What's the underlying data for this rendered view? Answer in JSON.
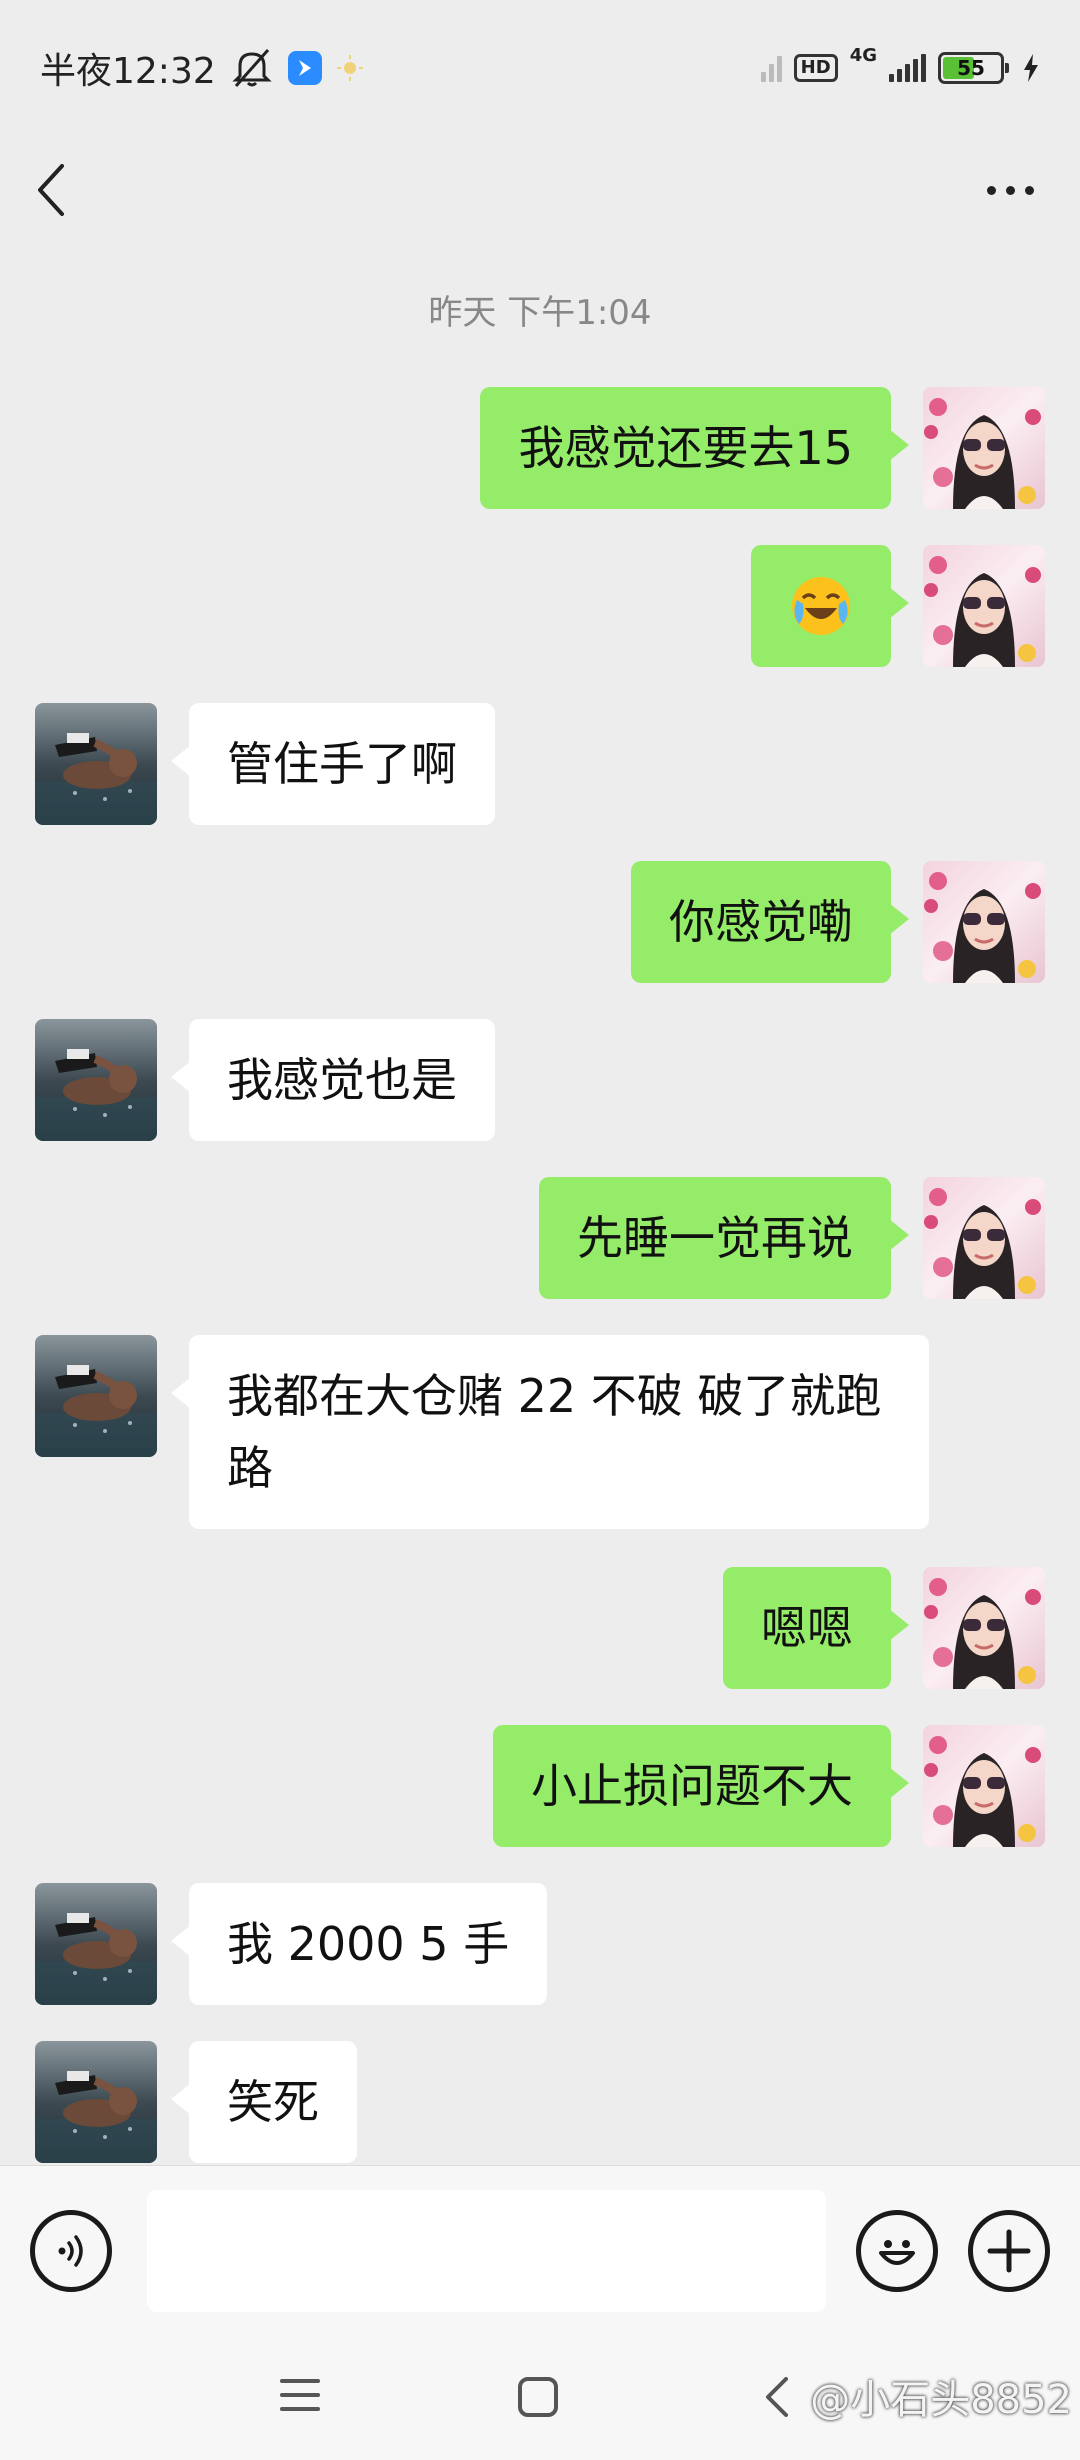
{
  "status_bar": {
    "time": "半夜12:32",
    "network_type": "4G",
    "hd_label": "HD",
    "battery_level": "55",
    "icons": [
      "mute-icon",
      "app-notification-icon",
      "weather-icon",
      "signal-icon",
      "battery-icon",
      "charging-icon"
    ]
  },
  "nav": {
    "back_icon": "chevron-left-icon",
    "title": "",
    "more_icon": "more-dots-icon"
  },
  "chat": {
    "timestamp": "昨天 下午1:04",
    "messages": [
      {
        "side": "right",
        "text": "我感觉还要去15"
      },
      {
        "side": "right",
        "text": "",
        "emoji": "crying-laughing-emoji"
      },
      {
        "side": "left",
        "text": "管住手了啊"
      },
      {
        "side": "right",
        "text": "你感觉嘞"
      },
      {
        "side": "left",
        "text": "我感觉也是"
      },
      {
        "side": "right",
        "text": "先睡一觉再说"
      },
      {
        "side": "left",
        "text": "我都在大仓赌 22 不破 破了就跑路"
      },
      {
        "side": "right",
        "text": "嗯嗯"
      },
      {
        "side": "right",
        "text": "小止损问题不大"
      },
      {
        "side": "left",
        "text": "我 2000 5 手"
      },
      {
        "side": "left",
        "text": "笑死"
      }
    ]
  },
  "input_bar": {
    "voice_icon": "voice-icon",
    "input_value": "",
    "emoji_icon": "emoji-icon",
    "plus_icon": "plus-icon"
  },
  "system_nav": {
    "menu_icon": "menu-icon",
    "home_icon": "home-icon",
    "back_icon": "back-icon",
    "watermark": "@小石头8852"
  },
  "colors": {
    "background": "#ededed",
    "outgoing_bubble": "#95ec69",
    "incoming_bubble": "#ffffff",
    "timestamp": "#888888"
  }
}
